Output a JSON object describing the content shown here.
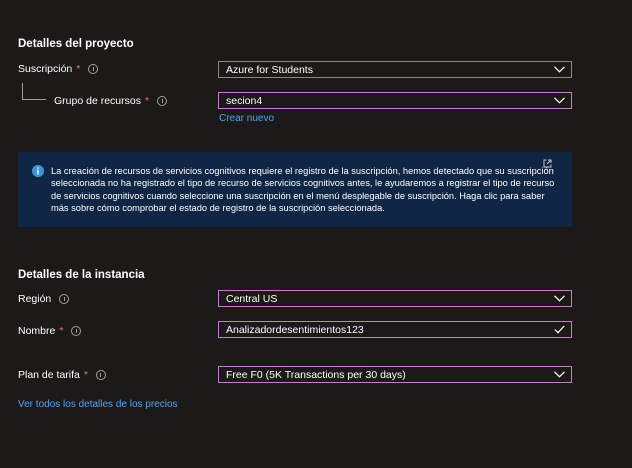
{
  "project": {
    "title": "Detalles del proyecto",
    "subscription": {
      "label": "Suscripción",
      "required": "*",
      "value": "Azure for Students"
    },
    "resource_group": {
      "label": "Grupo de recursos",
      "required": "*",
      "value": "secion4",
      "create_new": "Crear nuevo"
    }
  },
  "banner": {
    "text": "La creación de recursos de servicios cognitivos requiere el registro de la suscripción, hemos detectado que su suscripción seleccionada no ha registrado el tipo de recurso de servicios cognitivos antes, le ayudaremos a registrar el tipo de recurso de servicios cognitivos cuando seleccione una suscripción en el menú desplegable de suscripción. Haga clic para saber más sobre cómo comprobar el estado de registro de la suscripción seleccionada.",
    "icon": "info-icon",
    "link_icon": "external-link-icon",
    "background": "#0f2744"
  },
  "instance": {
    "title": "Detalles de la instancia",
    "region": {
      "label": "Región",
      "value": "Central US"
    },
    "name": {
      "label": "Nombre",
      "required": "*",
      "value": "Analizadordesentimientos123"
    }
  },
  "pricing": {
    "label": "Plan de tarifa",
    "required": "*",
    "value": "Free F0 (5K Transactions per 30 days)",
    "details_link": "Ver todos los detalles de los precios"
  },
  "colors": {
    "background": "#1b1a19",
    "focus_border": "#c77dcc",
    "link": "#4fa3f7",
    "required": "#f1707b",
    "valid_check": "#ffffff"
  }
}
